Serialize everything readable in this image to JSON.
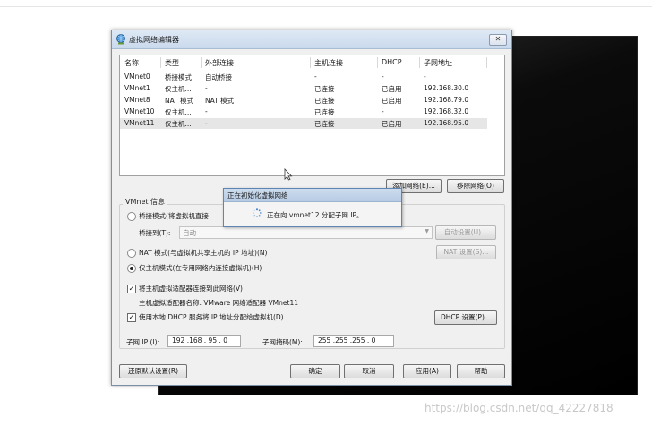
{
  "window": {
    "title": "虚拟网络编辑器",
    "close_label": "✕"
  },
  "table": {
    "headers": [
      "名称",
      "类型",
      "外部连接",
      "主机连接",
      "DHCP",
      "子网地址"
    ],
    "rows": [
      [
        "VMnet0",
        "桥接模式",
        "自动桥接",
        "-",
        "-",
        "-"
      ],
      [
        "VMnet1",
        "仅主机...",
        "-",
        "已连接",
        "已启用",
        "192.168.30.0"
      ],
      [
        "VMnet8",
        "NAT 模式",
        "NAT 模式",
        "已连接",
        "已启用",
        "192.168.79.0"
      ],
      [
        "VMnet10",
        "仅主机...",
        "-",
        "已连接",
        "-",
        "192.168.32.0"
      ],
      [
        "VMnet11",
        "仅主机...",
        "-",
        "已连接",
        "已启用",
        "192.168.95.0"
      ]
    ]
  },
  "buttons": {
    "add_network": "添加网络(E)...",
    "remove_network": "移除网络(O)",
    "auto_settings": "自动设置(U)...",
    "nat_settings": "NAT 设置(S)...",
    "dhcp_settings": "DHCP 设置(P)...",
    "restore_defaults": "还原默认设置(R)",
    "ok": "确定",
    "cancel": "取消",
    "apply": "应用(A)",
    "help": "帮助"
  },
  "vmnet_info": {
    "legend": "VMnet 信息",
    "bridged_label": "桥接模式(将虚拟机直接",
    "bridged_to_label": "桥接到(T):",
    "bridged_to_value": "自动",
    "nat_label": "NAT 模式(与虚拟机共享主机的 IP 地址)(N)",
    "hostonly_label": "仅主机模式(在专用网络内连接虚拟机)(H)",
    "connect_adapter_label": "将主机虚拟适配器连接到此网络(V)",
    "connect_adapter_checked": "✓",
    "adapter_name_label": "主机虚拟适配器名称: VMware 网络适配器 VMnet11",
    "dhcp_label": "使用本地 DHCP 服务将 IP 地址分配给虚拟机(D)",
    "dhcp_checked": "✓",
    "subnet_ip_label": "子网 IP (I):",
    "subnet_ip_value": "192 .168 . 95 . 0",
    "subnet_mask_label": "子网掩码(M):",
    "subnet_mask_value": "255 .255 .255 . 0",
    "selected_mode": "host-only"
  },
  "popup": {
    "title": "正在初始化虚拟网络",
    "message": "正在向 vmnet12 分配子网 IP。"
  },
  "watermark": "https://blog.csdn.net/qq_42227818",
  "colors": {
    "accent": "#5f86b3",
    "selected_row": "#e6e6e6",
    "backdrop": "#000000"
  }
}
